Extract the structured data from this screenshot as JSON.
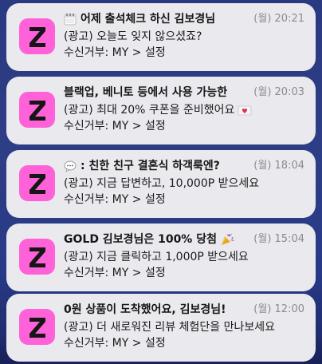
{
  "colors": {
    "app_icon": "#ff61d8",
    "card_bg": "#e9e9ee",
    "wallpaper": "#2d3e86"
  },
  "notifications": [
    {
      "icon": "calendar-icon",
      "title": "어제 출석체크 하신 김보경님",
      "time": "(월) 20:21",
      "body": "(광고) 오늘도 잊지 않으셨죠?",
      "sub": "수신거부: MY > 설정"
    },
    {
      "title": "블랙업, 베니토 등에서 사용 가능한",
      "time": "(월) 20:03",
      "body": "(광고) 최대 20% 쿠폰을 준비했어요",
      "body_icon": "love-letter-icon",
      "sub": "수신거부: MY > 설정"
    },
    {
      "icon": "speech-bubble-icon",
      "title": ": 친한 친구 결혼식 하객룩엔?",
      "time": "(월) 18:04",
      "body": "(광고) 지금 답변하고, 10,000P 받으세요",
      "sub": "수신거부: MY > 설정"
    },
    {
      "title": "GOLD 김보경님은 100% 당첨",
      "title_icon": "party-popper-icon",
      "time": "(월) 15:04",
      "body": "(광고) 지금 클릭하고 1,000P 받으세요",
      "sub": "수신거부: MY > 설정"
    },
    {
      "title": "0원 상품이 도착했어요, 김보경님!",
      "time": "(월) 12:00",
      "body": "(광고) 더 새로워진 리뷰 체험단을 만나보세요",
      "sub": "수신거부: MY > 설정"
    }
  ]
}
